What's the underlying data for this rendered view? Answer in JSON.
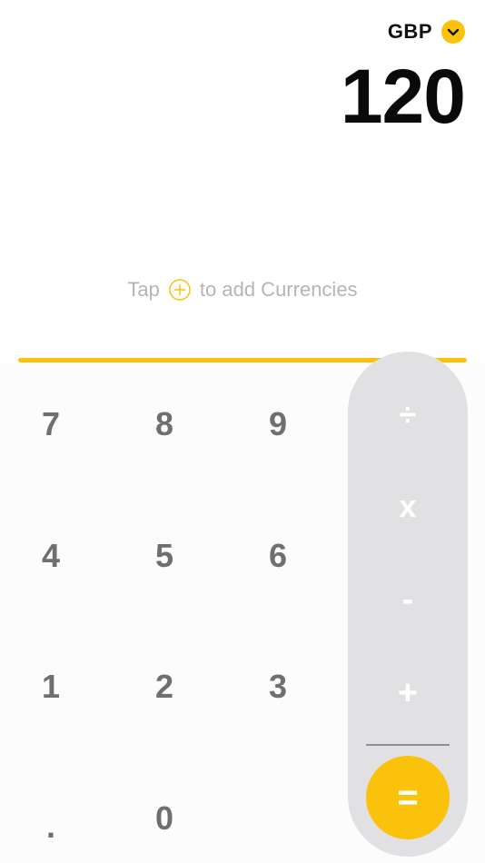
{
  "header": {
    "currency_code": "GBP",
    "currency_dropdown_icon": "chevron-down-icon",
    "amount": "120"
  },
  "hint": {
    "prefix": "Tap",
    "icon": "plus-circle-icon",
    "suffix": "to add Currencies"
  },
  "keypad": {
    "rows": [
      [
        "7",
        "8",
        "9"
      ],
      [
        "4",
        "5",
        "6"
      ],
      [
        "1",
        "2",
        "3"
      ],
      [
        ".",
        "0"
      ]
    ]
  },
  "operators": {
    "divide": "÷",
    "multiply": "x",
    "subtract": "-",
    "add": "+",
    "equals": "="
  },
  "colors": {
    "accent": "#FAC20A",
    "operator_panel": "#E1E1E3",
    "digit_text": "#6F6F72",
    "hint_text": "#B5B5B9",
    "amount_text": "#0A0A0A"
  }
}
